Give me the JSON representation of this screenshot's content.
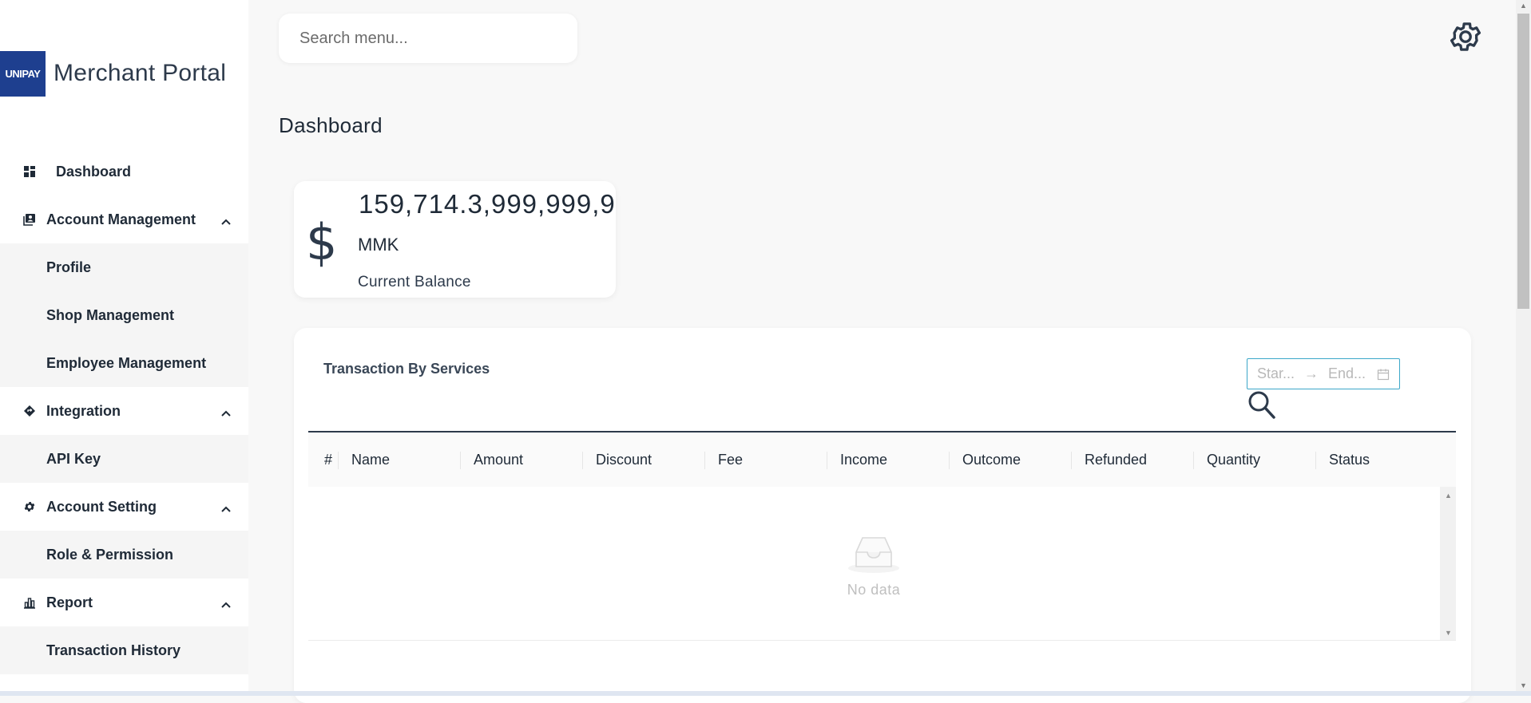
{
  "brand": {
    "logo_text": "UNIPAY",
    "title": "Merchant Portal"
  },
  "sidebar": {
    "items": [
      {
        "label": "Dashboard",
        "icon": "grid-icon"
      },
      {
        "label": "Account Management",
        "icon": "id-card-icon",
        "chevron": "up"
      },
      {
        "label": "Profile"
      },
      {
        "label": "Shop Management"
      },
      {
        "label": "Employee Management"
      },
      {
        "label": "Integration",
        "icon": "diamond-icon",
        "chevron": "up"
      },
      {
        "label": "API Key"
      },
      {
        "label": "Account Setting",
        "icon": "gear-icon",
        "chevron": "up"
      },
      {
        "label": "Role & Permission"
      },
      {
        "label": "Report",
        "icon": "bar-chart-icon",
        "chevron": "up"
      },
      {
        "label": "Transaction History"
      }
    ]
  },
  "topbar": {
    "search_placeholder": "Search menu...",
    "settings_icon": "gear-icon"
  },
  "page": {
    "title": "Dashboard"
  },
  "balance": {
    "symbol": "$",
    "amount": "159,714.3,999,999,9",
    "currency": "MMK",
    "label": "Current Balance"
  },
  "transactions": {
    "title": "Transaction By Services",
    "date_range": {
      "start_placeholder": "Star...",
      "end_placeholder": "End..."
    },
    "columns": [
      "#",
      "Name",
      "Amount",
      "Discount",
      "Fee",
      "Income",
      "Outcome",
      "Refunded",
      "Quantity",
      "Status"
    ],
    "rows": [],
    "empty_text": "No data"
  },
  "colors": {
    "brand": "#1e3f8f",
    "accent_border": "#3ba7c9",
    "text": "#1f2a37"
  }
}
